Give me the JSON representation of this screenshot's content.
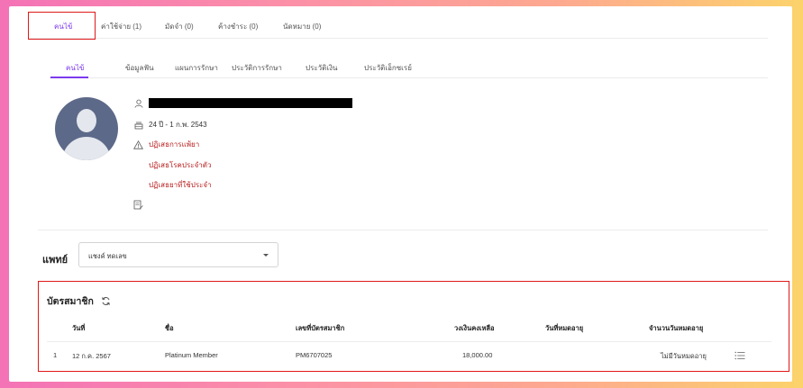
{
  "top_tabs": [
    {
      "label": "คนไข้",
      "active": true
    },
    {
      "label": "ค่าใช้จ่าย (1)",
      "active": false
    },
    {
      "label": "มัดจำ (0)",
      "active": false
    },
    {
      "label": "ค้างชำระ (0)",
      "active": false
    },
    {
      "label": "นัดหมาย (0)",
      "active": false
    }
  ],
  "sub_tabs": [
    {
      "label": "คนไข้",
      "active": true
    },
    {
      "label": "ข้อมูลฟัน",
      "active": false
    },
    {
      "label": "แผนการรักษา",
      "active": false
    },
    {
      "label": "ประวัติการรักษา",
      "active": false
    },
    {
      "label": "ประวัติเงิน",
      "active": false
    },
    {
      "label": "ประวัติเอ็กซเรย์",
      "active": false
    }
  ],
  "patient": {
    "age_birth": "24 ปี - 1 ก.พ. 2543",
    "allergy": "ปฏิเสธการแพ้ยา",
    "disease": "ปฏิเสธโรคประจำตัว",
    "medication": "ปฏิเสธยาที่ใช้ประจำ"
  },
  "doctor": {
    "label": "แพทย์",
    "selected": "แชงค์ ทดเลข"
  },
  "membership": {
    "title": "บัตรสมาชิก",
    "columns": [
      "วันที่",
      "ชื่อ",
      "เลขที่บัตรสมาชิก",
      "วงเงินคงเหลือ",
      "วันที่หมดอายุ",
      "จำนวนวันหมดอายุ"
    ],
    "rows": [
      {
        "no": "1",
        "date": "12 ก.ค. 2567",
        "name": "Platinum Member",
        "card_no": "PM6707025",
        "balance": "18,000.00",
        "expiry": "",
        "days_left": "ไม่มีวันหมดอายุ"
      }
    ]
  },
  "colors": {
    "accent": "#7c3aed",
    "highlight_border": "#e01818",
    "warning_text": "#b91c1c"
  }
}
